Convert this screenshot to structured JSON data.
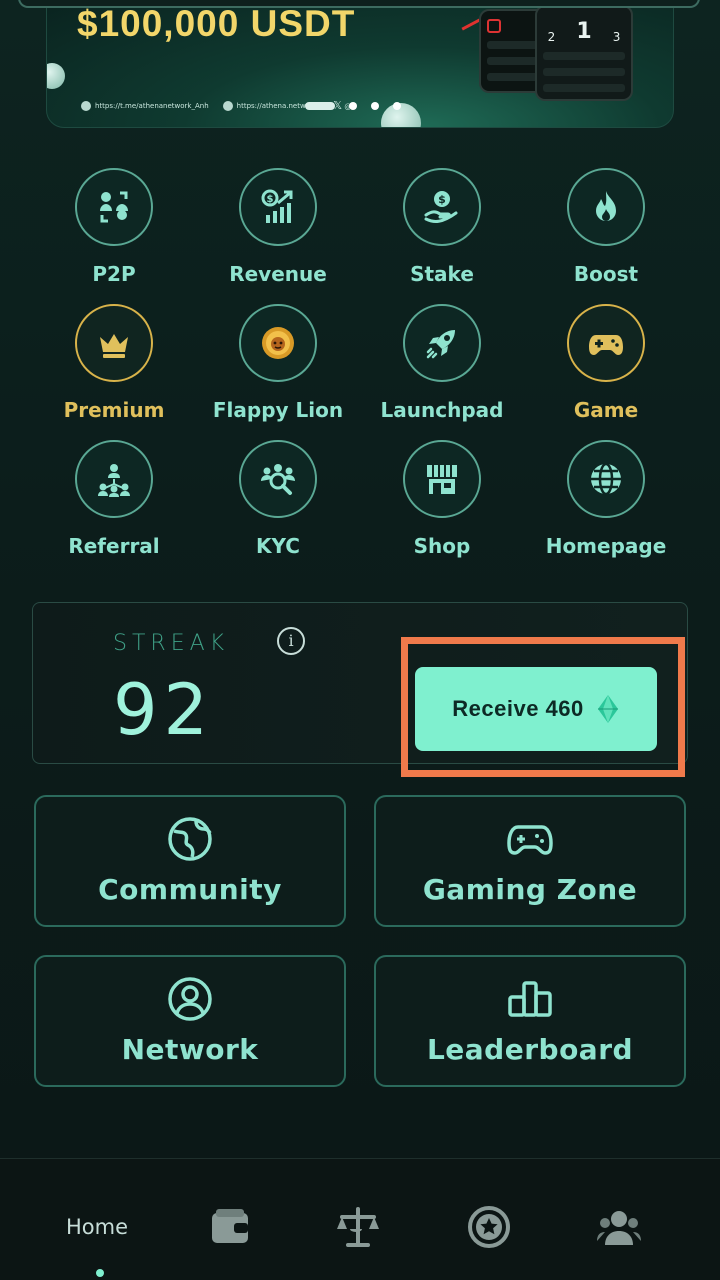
{
  "banner": {
    "title": "$100,000 USDT",
    "links": [
      "https://t.me/athenanetwork_Anh",
      "https://athena.network/",
      "@"
    ],
    "phone_rank_big": "1",
    "phone_rank_left": "2",
    "phone_rank_right": "3",
    "slides_total": 5,
    "slide_active": 1
  },
  "grid": {
    "items": [
      {
        "label": "P2P",
        "icon": "p2p-exchange-icon",
        "accent": "normal"
      },
      {
        "label": "Revenue",
        "icon": "revenue-chart-icon",
        "accent": "normal"
      },
      {
        "label": "Stake",
        "icon": "stake-coin-hand-icon",
        "accent": "normal"
      },
      {
        "label": "Boost",
        "icon": "flame-icon",
        "accent": "normal"
      },
      {
        "label": "Premium",
        "icon": "crown-icon",
        "accent": "gold"
      },
      {
        "label": "Flappy Lion",
        "icon": "lion-coin-icon",
        "accent": "normal"
      },
      {
        "label": "Launchpad",
        "icon": "rocket-icon",
        "accent": "normal"
      },
      {
        "label": "Game",
        "icon": "gamepad-icon",
        "accent": "gold"
      },
      {
        "label": "Referral",
        "icon": "referral-network-icon",
        "accent": "normal"
      },
      {
        "label": "KYC",
        "icon": "kyc-search-user-icon",
        "accent": "normal"
      },
      {
        "label": "Shop",
        "icon": "shop-store-icon",
        "accent": "normal"
      },
      {
        "label": "Homepage",
        "icon": "globe-icon",
        "accent": "normal"
      }
    ]
  },
  "streak": {
    "title": "STREAK",
    "value": "92",
    "receive_label": "Receive 460"
  },
  "cards": {
    "community": "Community",
    "gaming_zone": "Gaming Zone",
    "network": "Network",
    "leaderboard": "Leaderboard"
  },
  "nav": {
    "home": "Home",
    "items": [
      "wallet-icon",
      "balance-scale-icon",
      "star-badge-icon",
      "team-users-icon"
    ]
  },
  "colors": {
    "accent": "#7ff0cf",
    "text": "#8fe3cf",
    "gold": "#e0c05c",
    "highlight": "#f07a4b",
    "background": "#0b1a18"
  }
}
